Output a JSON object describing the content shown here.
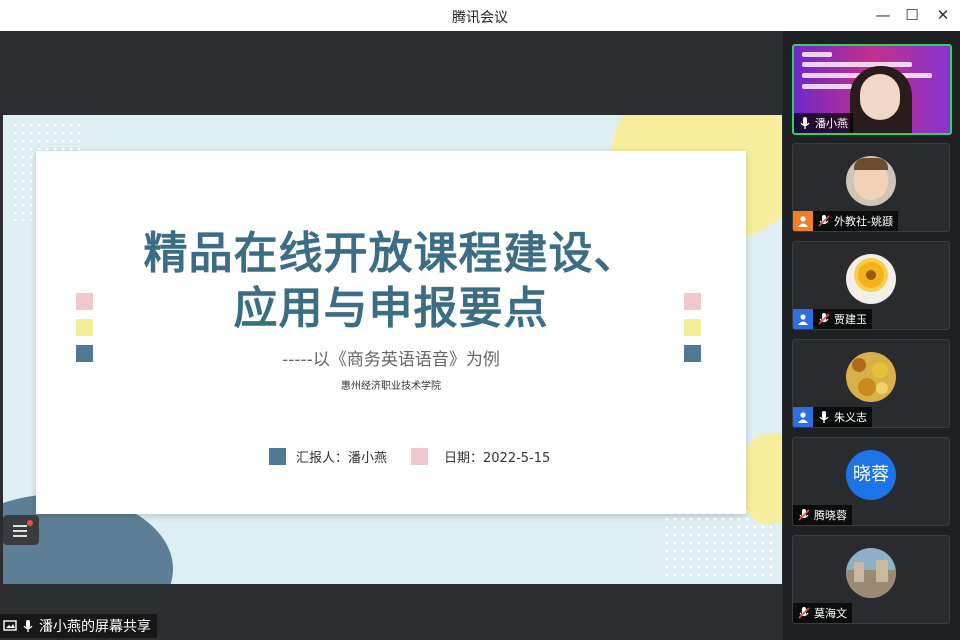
{
  "window": {
    "title": "腾讯会议"
  },
  "slide": {
    "title_line1": "精品在线开放课程建设、",
    "title_line2": "应用与申报要点",
    "subtitle": "-----以《商务英语语音》为例",
    "school": "惠州经济职业技术学院",
    "reporter": "汇报人：潘小燕",
    "date": "日期：2022-5-15"
  },
  "share_bar": {
    "label": "潘小燕的屏幕共享"
  },
  "participants": [
    {
      "name": "潘小燕",
      "type": "video-banner",
      "active": true,
      "banner_text": [
        "智慧赋能 提质培优",
        "职业教育数字化转型交流研讨会"
      ]
    },
    {
      "name": "外教社-姚颋",
      "type": "photo-child",
      "badge": "orange"
    },
    {
      "name": "贾建玉",
      "type": "photo-flower",
      "badge": "blue"
    },
    {
      "name": "朱义志",
      "type": "photo-sunflowers",
      "badge": "blue"
    },
    {
      "name": "腾晓蓉",
      "type": "text-avatar",
      "avatar_text": "晓蓉"
    },
    {
      "name": "莫海文",
      "type": "photo-building"
    }
  ],
  "colors": {
    "accent_green": "#2fd35f",
    "slide_title": "#3b6e85",
    "avatar_blue": "#1b74e8"
  }
}
